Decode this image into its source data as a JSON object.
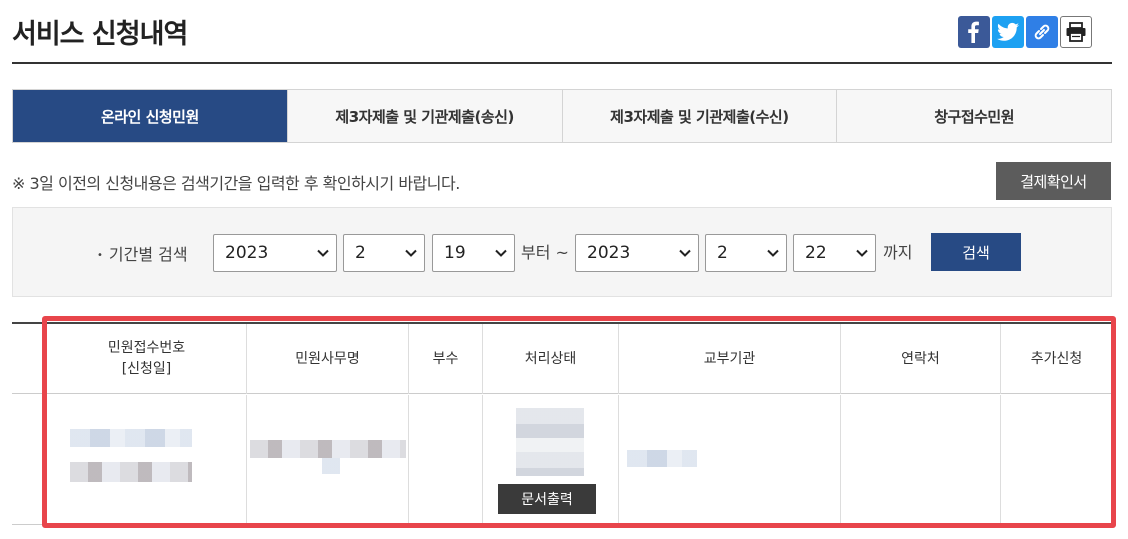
{
  "page": {
    "title": "서비스 신청내역"
  },
  "share": {
    "facebook_icon": "facebook-icon",
    "twitter_icon": "twitter-icon",
    "link_icon": "link-icon",
    "print_icon": "print-icon"
  },
  "tabs": [
    {
      "label": "온라인 신청민원",
      "active": true
    },
    {
      "label": "제3자제출 및 기관제출(송신)",
      "active": false
    },
    {
      "label": "제3자제출 및 기관제출(수신)",
      "active": false
    },
    {
      "label": "창구접수민원",
      "active": false
    }
  ],
  "notice": "※ 3일 이전의 신청내용은 검색기간을 입력한 후 확인하시기 바랍니다.",
  "payment_button": "결제확인서",
  "search": {
    "label": "기간별 검색",
    "from": {
      "year": "2023",
      "month": "2",
      "day": "19"
    },
    "from_suffix": "부터 ~",
    "to": {
      "year": "2023",
      "month": "2",
      "day": "22"
    },
    "to_suffix": "까지",
    "button": "검색"
  },
  "table": {
    "headers": {
      "receipt_no": "민원접수번호",
      "receipt_date": "[신청일]",
      "name": "민원사무명",
      "copies": "부수",
      "status": "처리상태",
      "agency": "교부기관",
      "contact": "연락처",
      "extra": "추가신청"
    },
    "row": {
      "print_button": "문서출력"
    }
  },
  "colors": {
    "primary": "#274a84",
    "highlight": "#e8454b",
    "payment_button": "#5c5c5c"
  }
}
